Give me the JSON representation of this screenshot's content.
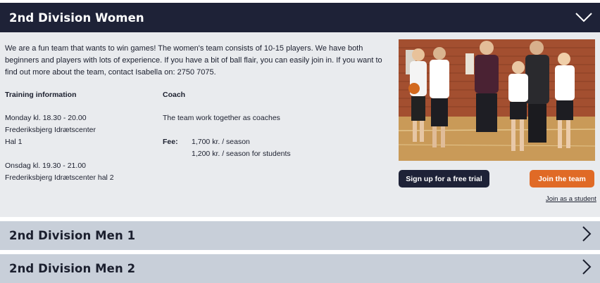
{
  "women": {
    "title": "2nd Division Women",
    "intro": "We are a fun team that wants to win games! The women's team consists of 10-15 players. We have both beginners and players with lots of experience. If you have a bit of ball flair, you can easily join in. If you want to find out more about the team, contact Isabella on: 2750 7075.",
    "training_heading": "Training information",
    "coach_heading": "Coach",
    "training_1_day": "Monday kl. 18.30 - 20.00",
    "training_1_place": "Frederiksbjerg Idrætscenter",
    "training_1_hall": "Hal 1",
    "training_2_day": "Onsdag kl. 19.30 - 21.00",
    "training_2_place": "Frederiksbjerg Idrætscenter hal 2",
    "coach_text": "The team work together as coaches",
    "fee_label": "Fee:",
    "fee_1": "1,700 kr. / season",
    "fee_2": "1,200 kr. / season for students",
    "trial_button": "Sign up for a free trial",
    "join_button": "Join the team",
    "student_link": "Join as a student",
    "icon": "chevron-down-icon"
  },
  "men1": {
    "title": "2nd Division Men 1",
    "icon": "chevron-right-icon"
  },
  "men2": {
    "title": "2nd Division Men 2",
    "icon": "chevron-right-icon"
  },
  "colors": {
    "header_dark": "#1e2237",
    "panel_bg": "#e9ebee",
    "collapsed_bg": "#c8cfd9",
    "accent_orange": "#e06a26"
  }
}
